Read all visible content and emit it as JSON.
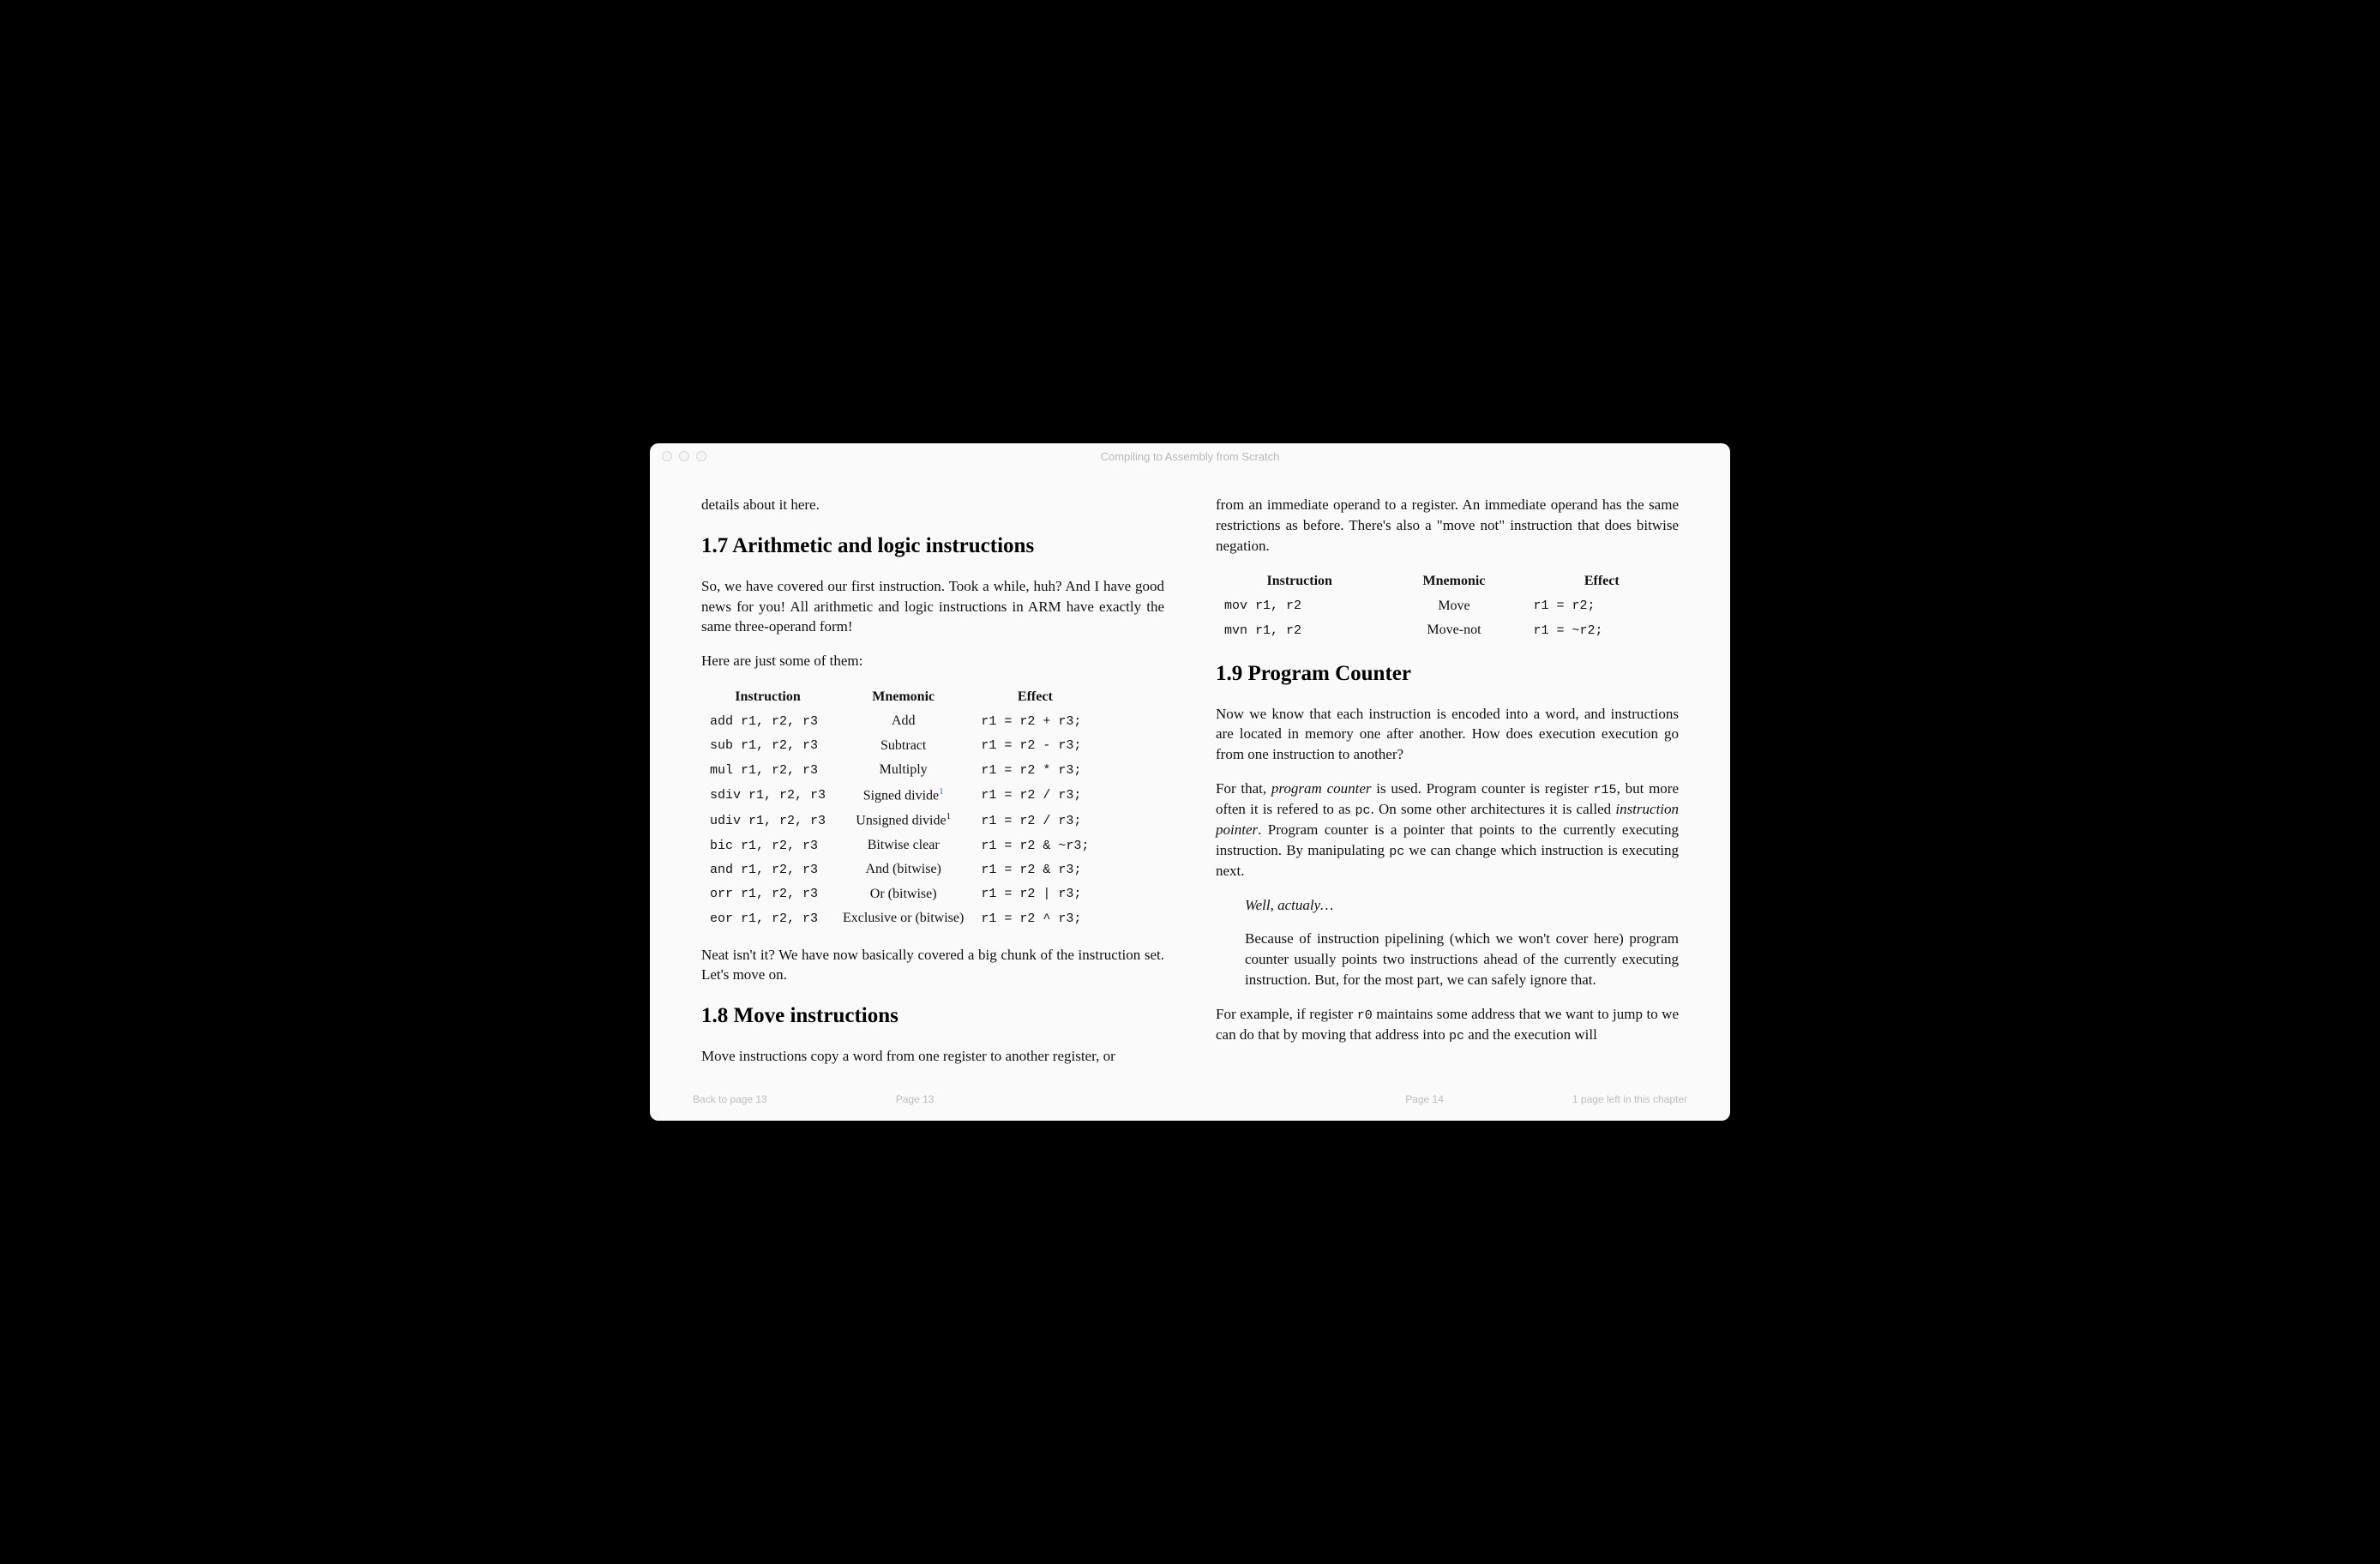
{
  "titlebar": {
    "title": "Compiling to Assembly from Scratch"
  },
  "left": {
    "intro_tail": "details about it here.",
    "h17": "1.7 Arithmetic and logic instructions",
    "p17a": "So, we have covered our first instruction. Took a while, huh? And I have good news for you! All arithmetic and logic instructions in ARM have exactly the same three-operand form!",
    "p17b": "Here are just some of them:",
    "table17": {
      "headers": [
        "Instruction",
        "Mnemonic",
        "Effect"
      ],
      "rows": [
        {
          "instr": "add  r1, r2, r3",
          "mnem": "Add",
          "sup": "",
          "eff": "r1 = r2 + r3;"
        },
        {
          "instr": "sub  r1, r2, r3",
          "mnem": "Subtract",
          "sup": "",
          "eff": "r1 = r2 - r3;"
        },
        {
          "instr": "mul  r1, r2, r3",
          "mnem": "Multiply",
          "sup": "",
          "eff": "r1 = r2 * r3;"
        },
        {
          "instr": "sdiv r1, r2, r3",
          "mnem": "Signed divide",
          "sup": "1",
          "suplink": true,
          "eff": "r1 = r2 / r3;"
        },
        {
          "instr": "udiv r1, r2, r3",
          "mnem": "Unsigned divide",
          "sup": "1",
          "suplink": false,
          "eff": "r1 = r2 / r3;"
        },
        {
          "instr": "bic  r1, r2, r3",
          "mnem": "Bitwise clear",
          "sup": "",
          "eff": "r1 = r2 & ~r3;"
        },
        {
          "instr": "and  r1, r2, r3",
          "mnem": "And (bitwise)",
          "sup": "",
          "eff": "r1 = r2 & r3;"
        },
        {
          "instr": "orr  r1, r2, r3",
          "mnem": "Or (bitwise)",
          "sup": "",
          "eff": "r1 = r2 | r3;"
        },
        {
          "instr": "eor  r1, r2, r3",
          "mnem": "Exclusive or (bitwise)",
          "sup": "",
          "eff": "r1 = r2 ^ r3;"
        }
      ]
    },
    "p17c": "Neat isn't it? We have now basically covered a big chunk of the instruction set. Let's move on.",
    "h18": "1.8 Move instructions",
    "p18a": "Move instructions copy a word from one register to another register, or"
  },
  "right": {
    "p18b": "from an immediate operand to a register. An immediate operand has the same restrictions as before. There's also a \"move not\" instruction that does bitwise negation.",
    "table18": {
      "headers": [
        "Instruction",
        "Mnemonic",
        "Effect"
      ],
      "rows": [
        {
          "instr": "mov r1, r2",
          "mnem": "Move",
          "eff": "r1 = r2;"
        },
        {
          "instr": "mvn r1, r2",
          "mnem": "Move-not",
          "eff": "r1 = ~r2;"
        }
      ]
    },
    "h19": "1.9 Program Counter",
    "p19a": "Now we know that each instruction is encoded into a word, and instructions are located in memory one after another. How does execution execution go from one instruction to another?",
    "p19b_pre": "For that, ",
    "p19b_em": "program counter",
    "p19b_mid1": " is used. Program counter is register ",
    "p19b_code1": "r15",
    "p19b_mid2": ", but more often it is refered to as ",
    "p19b_code2": "pc",
    "p19b_mid3": ". On some other architectures it is called ",
    "p19b_em2": "instruction pointer",
    "p19b_mid4": ". Program counter is a pointer that points to the currently executing instruction. By manipulating ",
    "p19b_code3": "pc",
    "p19b_end": " we can change which instruction is executing next.",
    "bq1": "Well, actualy…",
    "bq2": "Because of instruction pipelining (which we won't cover here) program counter usually points two instructions ahead of the currently executing instruction. But, for the most part, we can safely ignore that.",
    "p19c_pre": "For example, if register ",
    "p19c_code1": "r0",
    "p19c_mid": " maintains some address that we want to jump to we can do that by moving that address into ",
    "p19c_code2": "pc",
    "p19c_end": " and the execution will"
  },
  "footer": {
    "back": "Back to page 13",
    "left_page": "Page 13",
    "right_page": "Page 14",
    "remaining": "1 page left in this chapter"
  }
}
